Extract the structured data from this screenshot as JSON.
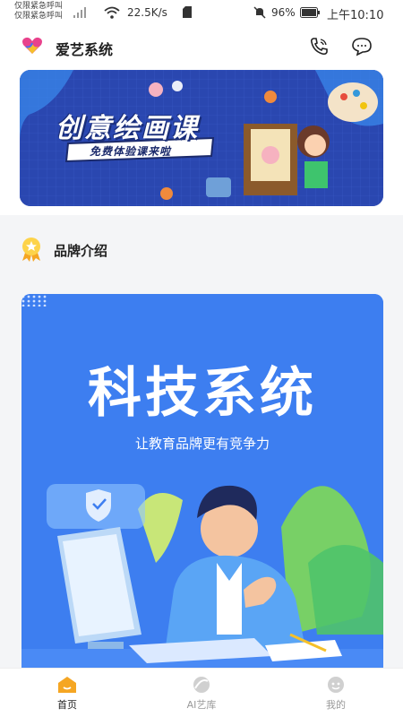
{
  "status_bar": {
    "carrier_line1": "仅限紧急呼叫",
    "carrier_line2": "仅限紧急呼叫",
    "net_speed": "22.5K/s",
    "battery": "96%",
    "time": "上午10:10"
  },
  "header": {
    "app_name": "爱艺系统",
    "icons": [
      "logo-heart-icon",
      "phone-icon",
      "chat-bubble-icon"
    ]
  },
  "banner": {
    "title": "创意绘画课",
    "subtitle": "免费体验课来啦"
  },
  "section": {
    "title": "品牌介绍",
    "icon": "medal-icon"
  },
  "poster": {
    "title": "科技系统",
    "subtitle": "让教育品牌更有竞争力"
  },
  "nav": {
    "items": [
      {
        "label": "首页",
        "icon": "home-icon",
        "active": true
      },
      {
        "label": "AI艺库",
        "icon": "ai-library-icon",
        "active": false
      },
      {
        "label": "我的",
        "icon": "profile-icon",
        "active": false
      }
    ]
  },
  "colors": {
    "accent": "#f5a623",
    "poster_blue": "#3d7ef0",
    "banner_blue": "#2b4bb8"
  }
}
